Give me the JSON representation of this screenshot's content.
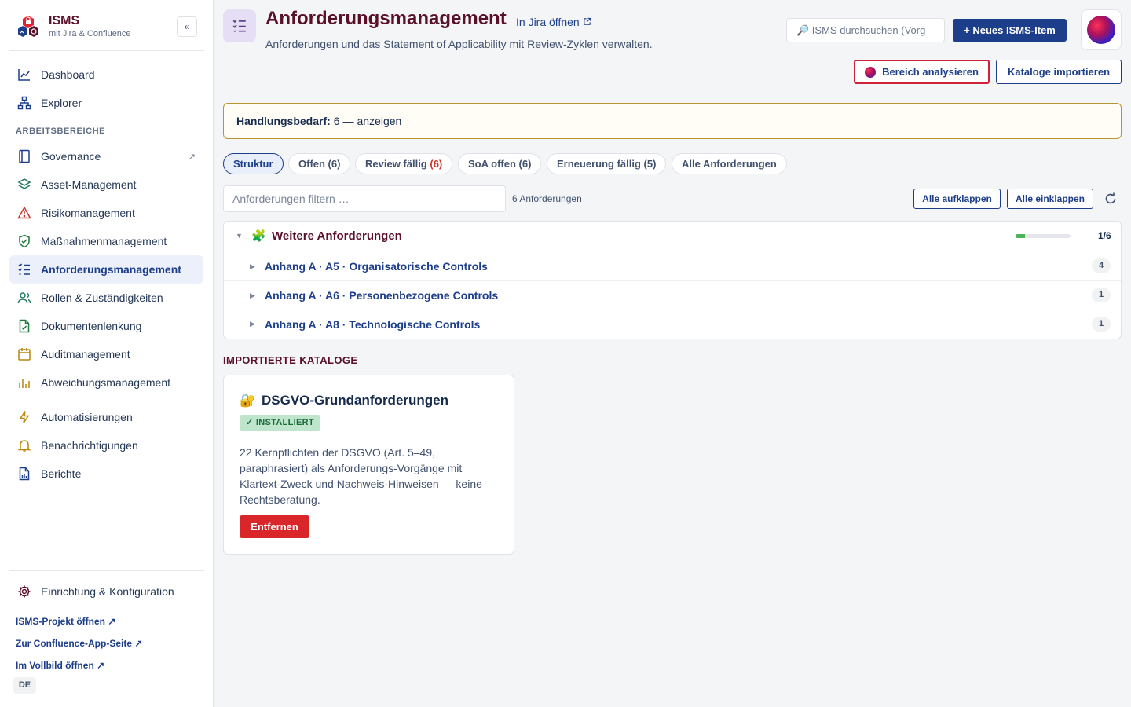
{
  "brand": {
    "title": "ISMS",
    "subtitle": "mit Jira & Confluence",
    "collapse_label": "«"
  },
  "sidebar": {
    "top_items": [
      {
        "label": "Dashboard",
        "icon": "chart-line-icon"
      },
      {
        "label": "Explorer",
        "icon": "hierarchy-icon"
      }
    ],
    "section_label": "ARBEITSBEREICHE",
    "items": [
      {
        "label": "Governance",
        "icon": "book-icon",
        "ext": "↗"
      },
      {
        "label": "Asset-Management",
        "icon": "layers-icon"
      },
      {
        "label": "Risikomanagement",
        "icon": "warning-icon"
      },
      {
        "label": "Maßnahmenmanagement",
        "icon": "shield-check-icon"
      },
      {
        "label": "Anforderungsmanagement",
        "icon": "checklist-icon",
        "active": true
      },
      {
        "label": "Rollen & Zuständigkeiten",
        "icon": "people-icon"
      },
      {
        "label": "Dokumentenlenkung",
        "icon": "document-check-icon"
      },
      {
        "label": "Auditmanagement",
        "icon": "calendar-icon"
      },
      {
        "label": "Abweichungsmanagement",
        "icon": "bar-chart-icon"
      },
      {
        "label": "Automatisierungen",
        "icon": "lightning-icon"
      },
      {
        "label": "Benachrichtigungen",
        "icon": "bell-icon"
      },
      {
        "label": "Berichte",
        "icon": "report-icon"
      }
    ],
    "settings": {
      "label": "Einrichtung & Konfiguration",
      "icon": "gear-icon"
    },
    "footer_links": [
      "ISMS-Projekt öffnen ↗",
      "Zur Confluence-App-Seite ↗",
      "Im Vollbild öffnen ↗"
    ],
    "language": "DE"
  },
  "header": {
    "title": "Anforderungsmanagement",
    "jira_link": "In Jira öffnen",
    "description": "Anforderungen und das Statement of Applicability mit Review-Zyklen verwalten.",
    "search_placeholder": "🔎 ISMS durchsuchen (Vorg",
    "new_item_label": "+ Neues ISMS-Item",
    "analyse_label": "Bereich analysieren",
    "import_label": "Kataloge importieren"
  },
  "alert": {
    "label": "Handlungsbedarf:",
    "value": "6 —",
    "link": "anzeigen"
  },
  "tabs": [
    {
      "label": "Struktur",
      "active": true
    },
    {
      "label": "Offen (6)"
    },
    {
      "label": "Review fällig ",
      "red": "(6)"
    },
    {
      "label": "SoA offen (6)"
    },
    {
      "label": "Erneuerung fällig (5)"
    },
    {
      "label": "Alle Anforderungen"
    }
  ],
  "filter": {
    "placeholder": "Anforderungen filtern …",
    "count": "6 Anforderungen",
    "expand_all": "Alle aufklappen",
    "collapse_all": "Alle einklappen"
  },
  "tree": {
    "group": {
      "title": "Weitere Anforderungen",
      "progress_label": "1/6",
      "progress_fraction": 0.167
    },
    "children": [
      {
        "title": "Anhang A · A5 · Organisatorische Controls",
        "count": "4"
      },
      {
        "title": "Anhang A · A6 · Personenbezogene Controls",
        "count": "1"
      },
      {
        "title": "Anhang A · A8 · Technologische Controls",
        "count": "1"
      }
    ]
  },
  "catalogs": {
    "heading": "IMPORTIERTE KATALOGE",
    "card": {
      "icon": "🔐",
      "title": "DSGVO-Grundanforderungen",
      "status": "✓ INSTALLIERT",
      "description": "22 Kernpflichten der DSGVO (Art. 5–49, paraphrasiert) als Anforderungs-Vorgänge mit Klartext-Zweck und Nachweis-Hinweisen — keine Rechtsberatung.",
      "remove_label": "Entfernen"
    }
  },
  "colors": {
    "brand": "#5a1028",
    "primary": "#1d3e8a",
    "danger": "#d9262b",
    "success": "#4bb45a"
  }
}
